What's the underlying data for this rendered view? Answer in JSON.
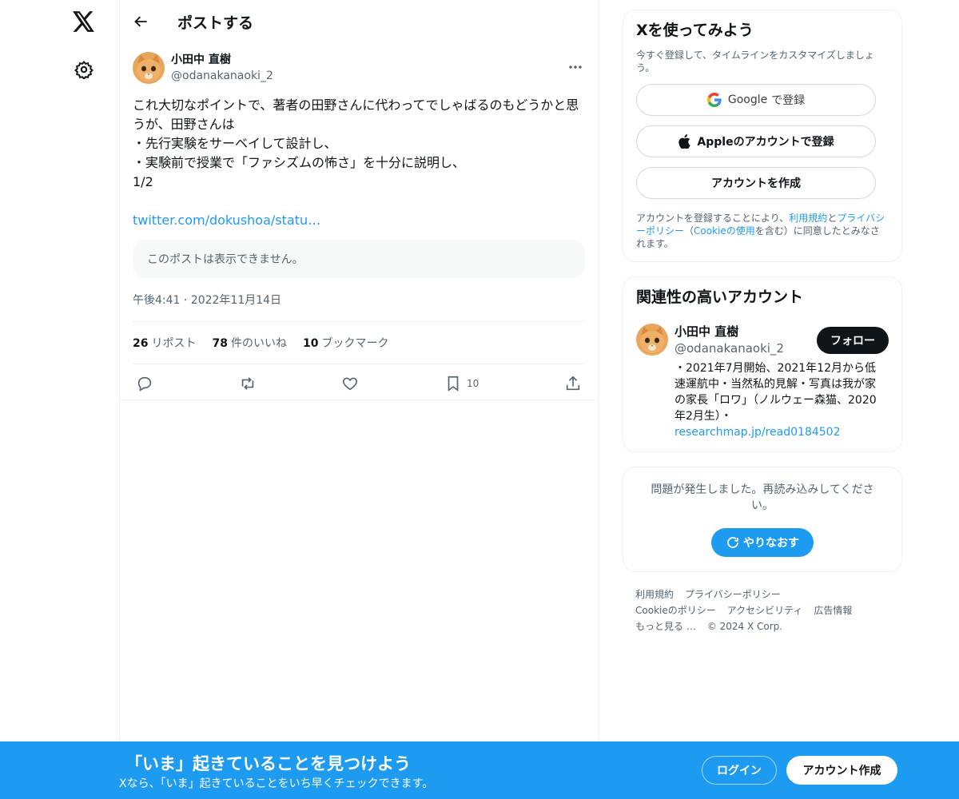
{
  "nav": {
    "logo_icon": "x-logo-icon",
    "settings_icon": "gear-icon"
  },
  "header": {
    "title": "ポストする"
  },
  "post": {
    "author_name": "小田中 直樹",
    "author_handle": "@odanakanaoki_2",
    "text": "これ大切なポイントで、著者の田野さんに代わってでしゃばるのもどうかと思うが、田野さんは\n・先行実験をサーベイして設計し、\n・実験前で授業で「ファシズムの怖さ」を十分に説明し、\n1/2",
    "link": "twitter.com/dokushoa/statu…",
    "unavailable": "このポストは表示できません。",
    "time": "午後4:41 · 2022年11月14日",
    "stats": {
      "reposts_count": "26",
      "reposts_label": "リポスト",
      "likes_count": "78",
      "likes_label": "件のいいね",
      "bookmarks_count": "10",
      "bookmarks_label": "ブックマーク"
    },
    "actions": {
      "bookmark_count": "10"
    }
  },
  "signup": {
    "title": "Xを使ってみよう",
    "subtitle": "今すぐ登録して、タイムラインをカスタマイズしましょう。",
    "google_label": "Google",
    "google_suffix": "で登録",
    "apple_label": "Appleのアカウントで登録",
    "create_label": "アカウントを作成",
    "terms_1": "アカウントを登録することにより、",
    "terms_link1": "利用規約",
    "terms_2": "と",
    "terms_link2": "プライバシーポリシー",
    "terms_3": "（",
    "terms_link3": "Cookieの使用",
    "terms_4": "を含む）に同意したとみなされます。"
  },
  "recommend": {
    "title": "関連性の高いアカウント",
    "name": "小田中 直樹",
    "handle": "@odanakanaoki_2",
    "follow_label": "フォロー",
    "bio": "・2021年7月開始、2021年12月から低速運航中・当然私的見解・写真は我が家の家長「ロワ」（ノルウェー森猫、2020年2月生）・",
    "bio_link": "researchmap.jp/read0184502"
  },
  "error": {
    "text": "問題が発生しました。再読み込みしてください。",
    "retry_label": "やりなおす"
  },
  "footer": {
    "terms": "利用規約",
    "privacy": "プライバシーポリシー",
    "cookie": "Cookieのポリシー",
    "accessibility": "アクセシビリティ",
    "ads": "広告情報",
    "more": "もっと見る …",
    "copyright": "© 2024 X Corp."
  },
  "bottombar": {
    "title": "「いま」起きていることを見つけよう",
    "subtitle": "Xなら、「いま」起きていることをいち早くチェックできます。",
    "login_label": "ログイン",
    "signup_label": "アカウント作成"
  },
  "colors": {
    "accent": "#1d9bf0",
    "text": "#0f1419",
    "muted": "#536471"
  }
}
